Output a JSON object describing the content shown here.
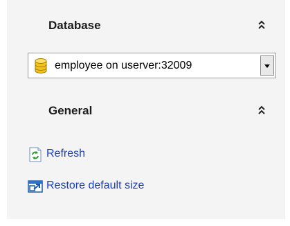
{
  "database_section": {
    "title": "Database",
    "collapse_icon": "double-chevron-up-icon",
    "combo": {
      "icon": "database-cylinder-icon",
      "selected_value": "employee on userver:32009",
      "dropdown_icon": "chevron-down-icon"
    }
  },
  "general_section": {
    "title": "General",
    "collapse_icon": "double-chevron-up-icon",
    "actions": [
      {
        "label": "Refresh",
        "icon": "refresh-icon"
      },
      {
        "label": "Restore default size",
        "icon": "restore-window-icon"
      }
    ]
  },
  "colors": {
    "panel_background": "#f4f4f4",
    "link": "#1a40c0",
    "title": "#1c1c1c"
  }
}
